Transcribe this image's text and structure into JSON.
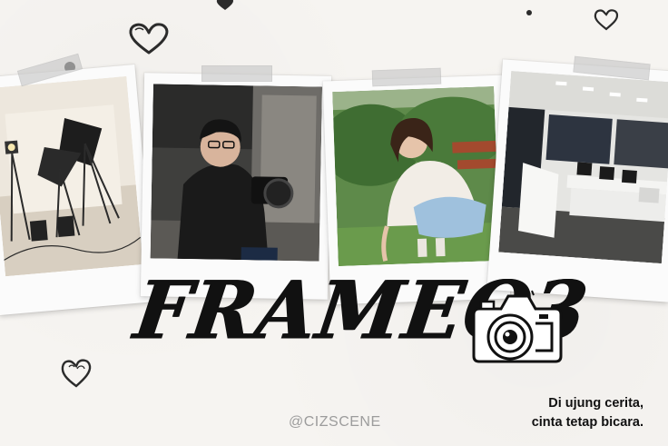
{
  "brand": {
    "title": "FRAMEO3",
    "tagline_line1": "Di ujung cerita,",
    "tagline_line2": "cinta tetap bicara.",
    "handle": "@CIZSCENE"
  },
  "icons": {
    "camera": "camera-icon",
    "heart": "heart-icon"
  },
  "colors": {
    "background": "#f6f4f1",
    "ink": "#111111",
    "handle": "#9c9c9c",
    "polaroid": "#fbfbfb"
  }
}
